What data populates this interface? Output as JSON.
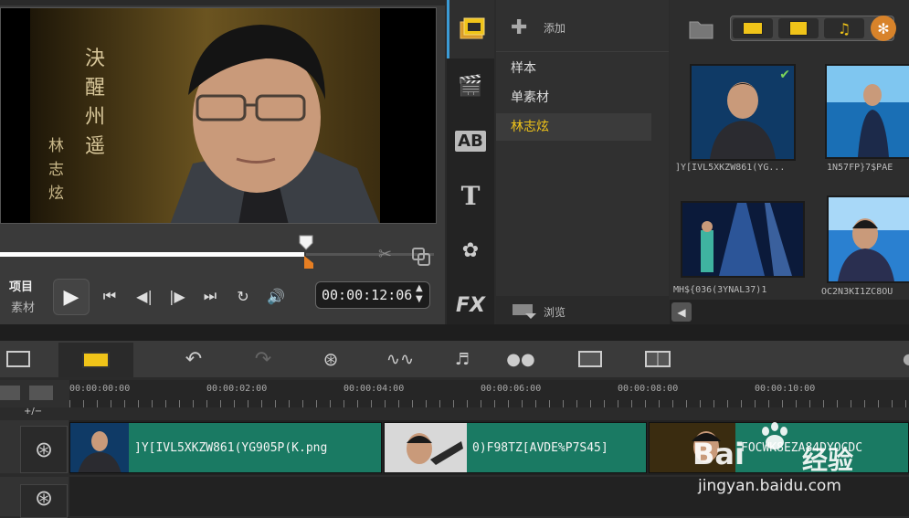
{
  "preview": {
    "overlay_text_1": "決醒州遥",
    "overlay_text_2": "林志炫",
    "mode_project": "项目",
    "mode_clip": "素材",
    "timecode": "00:00:12:06",
    "scrub_progress": 0.7
  },
  "library": {
    "add_label": "添加",
    "browse_label": "浏览",
    "folders": [
      "样本",
      "单素材",
      "林志炫"
    ],
    "selected_folder": "林志炫",
    "thumbs": [
      {
        "label": "]Y[IVL5XKZW861(YG..."
      },
      {
        "label": "1N57FP}7$PAE"
      },
      {
        "label": "MH${036(3YNAL37)1"
      },
      {
        "label": "OC2N3KI1ZC8OU"
      }
    ]
  },
  "timeline": {
    "ticks": [
      "00:00:00:00",
      "00:00:02:00",
      "00:00:04:00",
      "00:00:06:00",
      "00:00:08:00",
      "00:00:10:00"
    ],
    "add_remove_label": "+/−",
    "clips": [
      {
        "name": "]Y[IVL5XKZW861(YG905P(K.png"
      },
      {
        "name": "0)F98TZ[AVDE%P7S45]"
      },
      {
        "name": "FOCWK8EZA84DYOCDC"
      }
    ]
  },
  "watermark": {
    "brand": "Bai",
    "brand_cn": "经验",
    "url": "jingyan.baidu.com"
  },
  "colors": {
    "accent": "#f0c419",
    "clip": "#1a7a63",
    "scrub_marker": "#e67e22"
  }
}
